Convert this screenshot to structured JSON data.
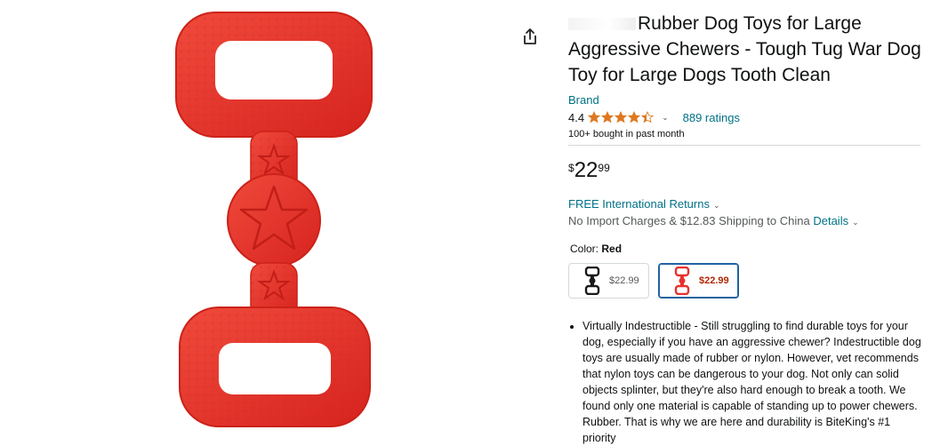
{
  "product": {
    "title": "Rubber Dog Toys for Large Aggressive Chewers - Tough Tug War Dog Toy for Large Dogs Tooth Clean",
    "brand_link": "Brand",
    "rating_value": "4.4",
    "rating_stars": 4.4,
    "ratings_count": "889 ratings",
    "bought": "100+ bought in past month"
  },
  "price": {
    "symbol": "$",
    "whole": "22",
    "fraction": "99"
  },
  "delivery": {
    "returns": "FREE International Returns",
    "shipping_text": "No Import Charges & $12.83 Shipping to China",
    "details_link": "Details"
  },
  "variant": {
    "label": "Color:",
    "selected": "Red",
    "options": [
      {
        "name": "Black",
        "price": "$22.99",
        "color": "#1a1a1a"
      },
      {
        "name": "Red",
        "price": "$22.99",
        "color": "#e8322f"
      }
    ]
  },
  "bullets": [
    "Virtually Indestructible - Still struggling to find durable toys for your dog, especially if you have an aggressive chewer? Indestructible dog toys are usually made of rubber or nylon. However, vet recommends that nylon toys can be dangerous to your dog. Not only can solid objects splinter, but they're also hard enough to break a tooth. We found only one material is capable of standing up to power chewers. Rubber. That is why we are here and durability is BiteKing's #1 priority"
  ],
  "colors": {
    "link": "#007185",
    "star": "#de7921",
    "price_sale": "#b12704",
    "product_red": "#e8322f",
    "selected_border": "#2162a1"
  }
}
